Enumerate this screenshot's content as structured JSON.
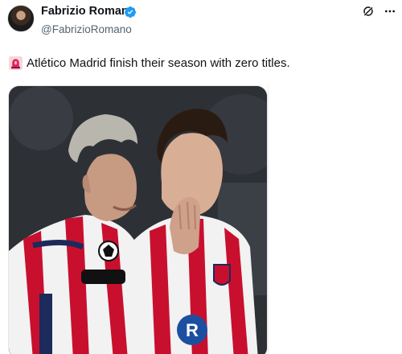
{
  "tweet": {
    "author": {
      "display_name": "Fabrizio Romano",
      "handle": "@FabrizioRomano",
      "verified": true,
      "avatar_icon": "avatar-photo"
    },
    "text": "Atlético Madrid finish their season with zero titles.",
    "emoji_icon": "police-siren-icon",
    "actions": {
      "grok_icon": "grok-icon",
      "more_icon": "more-dots-icon"
    },
    "media": {
      "type": "photo",
      "description_icon": "football-players-photo"
    }
  },
  "colors": {
    "text_primary": "#0f1419",
    "text_secondary": "#536471",
    "verified_blue": "#1d9bf0",
    "siren_red": "#e0245e",
    "kit_red": "#c8102e"
  }
}
